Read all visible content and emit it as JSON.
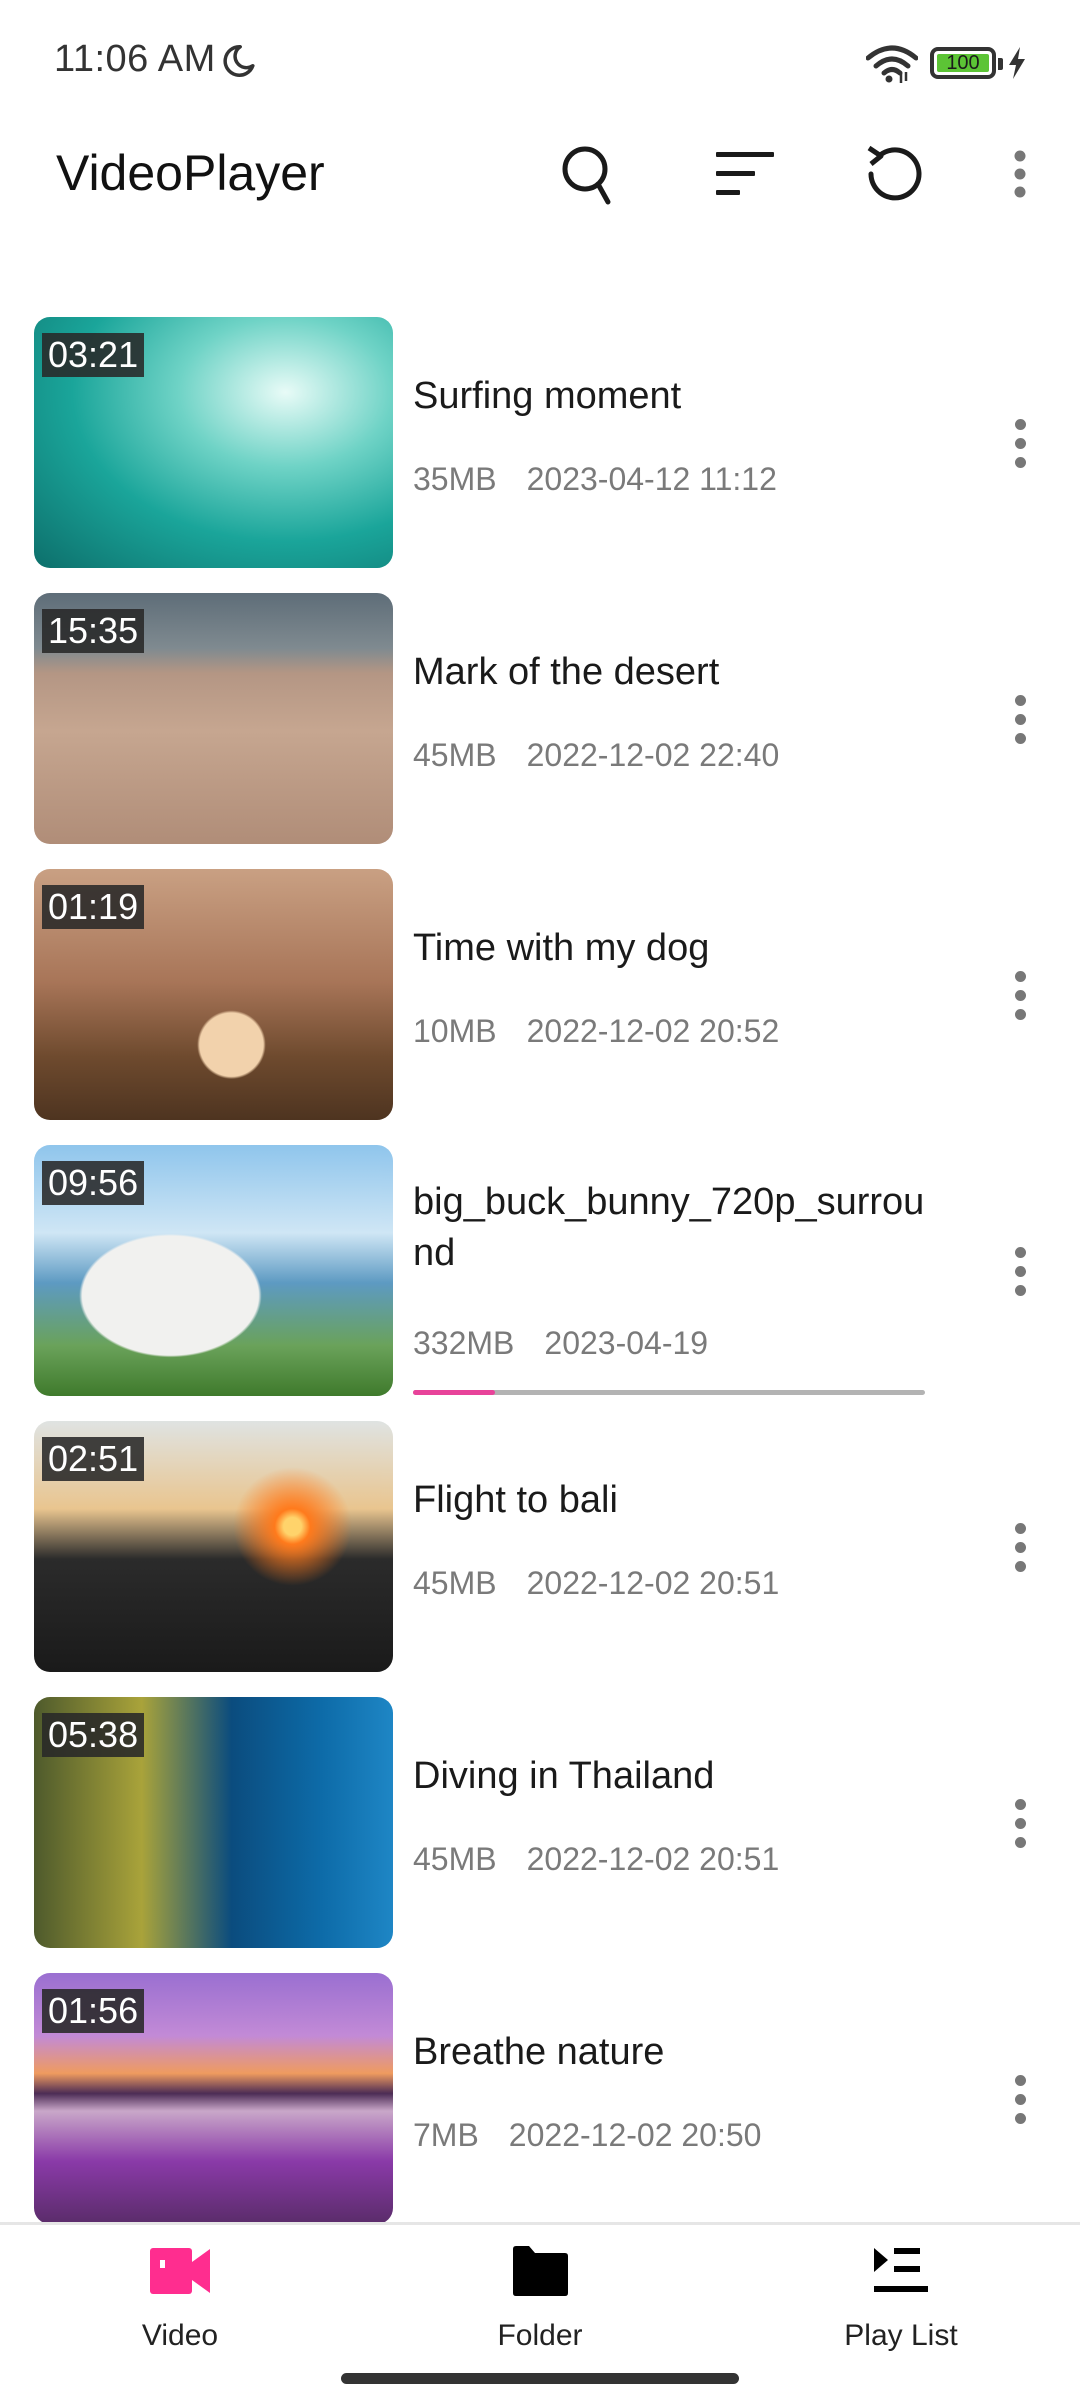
{
  "status_bar": {
    "time": "11:06 AM",
    "battery_level": "100",
    "icons": [
      "moon-icon",
      "wifi-icon",
      "battery-icon",
      "charging-bolt-icon"
    ]
  },
  "app_bar": {
    "title": "VideoPlayer",
    "actions": [
      "search-icon",
      "sort-icon",
      "refresh-icon",
      "more-vert-icon"
    ]
  },
  "videos": [
    {
      "title": "Surfing moment",
      "duration": "03:21",
      "size": "35MB",
      "date": "2023-04-12 11:12"
    },
    {
      "title": "Mark of the desert",
      "duration": "15:35",
      "size": "45MB",
      "date": "2022-12-02 22:40"
    },
    {
      "title": "Time with my dog",
      "duration": "01:19",
      "size": "10MB",
      "date": "2022-12-02 20:52"
    },
    {
      "title": "big_buck_bunny_720p_surround",
      "duration": "09:56",
      "size": "332MB",
      "date": "2023-04-19",
      "progress_percent": 16
    },
    {
      "title": "Flight to bali",
      "duration": "02:51",
      "size": "45MB",
      "date": "2022-12-02 20:51"
    },
    {
      "title": "Diving in Thailand",
      "duration": "05:38",
      "size": "45MB",
      "date": "2022-12-02 20:51"
    },
    {
      "title": "Breathe nature",
      "duration": "01:56",
      "size": "7MB",
      "date": "2022-12-02 20:50"
    }
  ],
  "bottom_nav": {
    "items": [
      {
        "label": "Video",
        "icon": "video-camera-icon",
        "active": true
      },
      {
        "label": "Folder",
        "icon": "folder-icon",
        "active": false
      },
      {
        "label": "Play List",
        "icon": "playlist-icon",
        "active": false
      }
    ]
  },
  "colors": {
    "accent": "#ff2d8f",
    "progress": "#e8439a",
    "progress_track": "#b3b3b3",
    "battery": "#5cc435",
    "meta_text": "#7a7a7a"
  }
}
